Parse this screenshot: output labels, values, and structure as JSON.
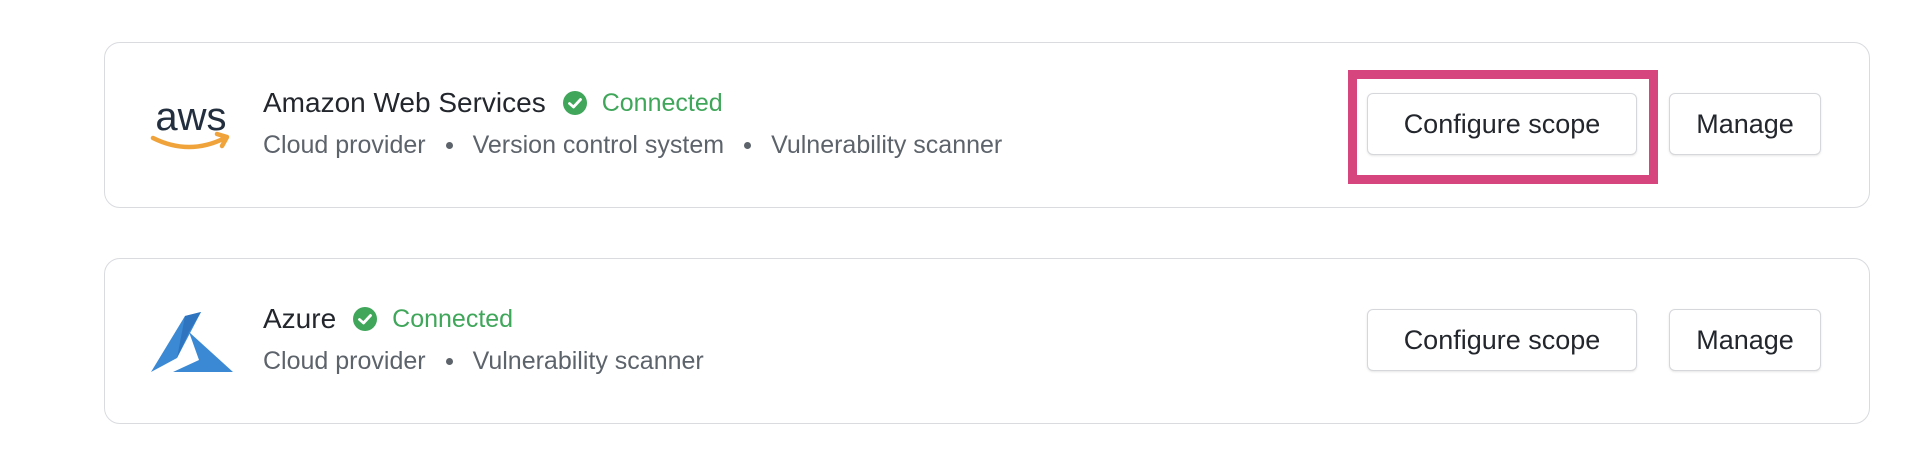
{
  "integrations": [
    {
      "id": "aws",
      "name": "Amazon Web Services",
      "status": "Connected",
      "tags": [
        "Cloud provider",
        "Version control system",
        "Vulnerability scanner"
      ],
      "logo_text": "aws",
      "configure_label": "Configure scope",
      "manage_label": "Manage"
    },
    {
      "id": "azure",
      "name": "Azure",
      "status": "Connected",
      "tags": [
        "Cloud provider",
        "Vulnerability scanner"
      ],
      "configure_label": "Configure scope",
      "manage_label": "Manage"
    }
  ],
  "colors": {
    "connected": "#3fa65a",
    "highlight": "#d6457d",
    "aws_text": "#232f3e",
    "aws_smile": "#f0a33a",
    "azure_blue": "#3b89d4"
  },
  "icons": {
    "aws_logo": "aws-logo-icon",
    "azure_logo": "azure-logo-icon",
    "status": "check-circle-icon"
  }
}
